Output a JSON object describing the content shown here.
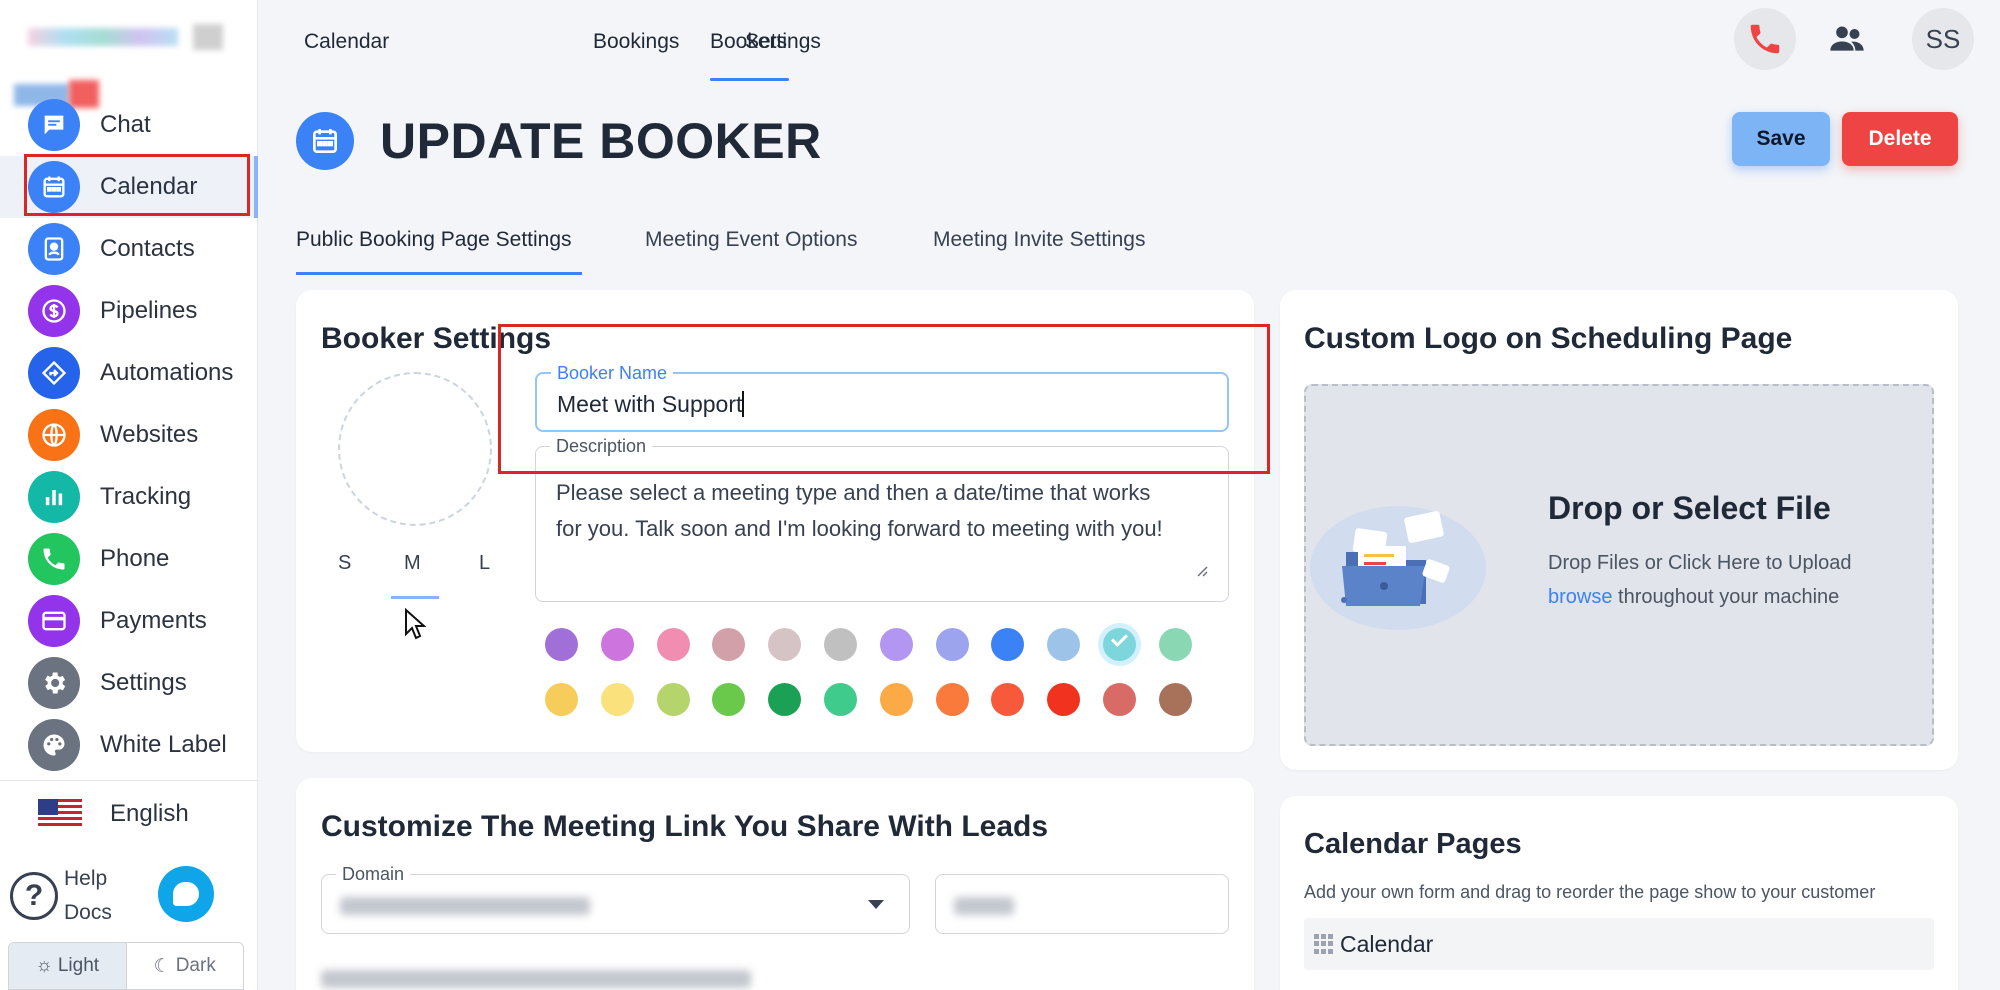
{
  "sidebar": {
    "items": [
      {
        "label": "Chat",
        "icon": "chat-icon",
        "color": "#3b82f6"
      },
      {
        "label": "Calendar",
        "icon": "calendar-icon",
        "color": "#3b82f6"
      },
      {
        "label": "Contacts",
        "icon": "contacts-icon",
        "color": "#3b82f6"
      },
      {
        "label": "Pipelines",
        "icon": "dollar-icon",
        "color": "#9333ea"
      },
      {
        "label": "Automations",
        "icon": "automation-icon",
        "color": "#2563eb"
      },
      {
        "label": "Websites",
        "icon": "globe-icon",
        "color": "#f97316"
      },
      {
        "label": "Tracking",
        "icon": "bar-chart-icon",
        "color": "#14b8a6"
      },
      {
        "label": "Phone",
        "icon": "phone-icon",
        "color": "#22c55e"
      },
      {
        "label": "Payments",
        "icon": "card-icon",
        "color": "#9333ea"
      },
      {
        "label": "Settings",
        "icon": "gear-icon",
        "color": "#6b7280"
      },
      {
        "label": "White Label",
        "icon": "palette-icon",
        "color": "#6b7280"
      }
    ],
    "active_item": "Calendar",
    "language": "English",
    "help_line1": "Help",
    "help_line2": "Docs",
    "theme_light": "Light",
    "theme_dark": "Dark"
  },
  "topnav": {
    "tabs": [
      "Calendar",
      "Bookers",
      "Bookings",
      "Settings"
    ],
    "active_tab": "Bookers",
    "user_initials": "SS"
  },
  "header": {
    "title": "UPDATE BOOKER",
    "save_label": "Save",
    "delete_label": "Delete"
  },
  "subtabs": {
    "items": [
      "Public Booking Page Settings",
      "Meeting Event Options",
      "Meeting Invite Settings"
    ],
    "active": "Public Booking Page Settings"
  },
  "booker_settings": {
    "title": "Booker Settings",
    "sizes": [
      "S",
      "M",
      "L"
    ],
    "selected_size": "M",
    "name_label": "Booker Name",
    "name_value": "Meet with Support",
    "description_label": "Description",
    "description_value": "Please select a meeting type and then a date/time that works for you. Talk soon and I'm looking forward to meeting with you!",
    "colors_row1": [
      "#a070d8",
      "#cd74de",
      "#f28db2",
      "#d2a0a8",
      "#d6c3c5",
      "#c0c0c0",
      "#b296f2",
      "#9ca4ee",
      "#3b82f6",
      "#9dc3e8",
      "#7dd6db",
      "#8ad8b3"
    ],
    "colors_row2": [
      "#f6cc5a",
      "#fae17c",
      "#b5d46c",
      "#6ac84a",
      "#1aa155",
      "#3ecb8b",
      "#fbaa45",
      "#f97a3a",
      "#f75a3a",
      "#f0321e",
      "#d86b66",
      "#a8715a"
    ],
    "selected_color": "#7dd6db"
  },
  "custom_logo": {
    "title": "Custom Logo on Scheduling Page",
    "drop_title": "Drop or Select File",
    "drop_text_before": "Drop Files or Click Here to Upload",
    "drop_link": "browse",
    "drop_text_after": "throughout your machine"
  },
  "meeting_link": {
    "title": "Customize The Meeting Link You Share With Leads",
    "domain_label": "Domain"
  },
  "calendar_pages": {
    "title": "Calendar Pages",
    "subtitle": "Add your own form and drag to reorder the page show to your customer",
    "rows": [
      "Calendar"
    ]
  }
}
